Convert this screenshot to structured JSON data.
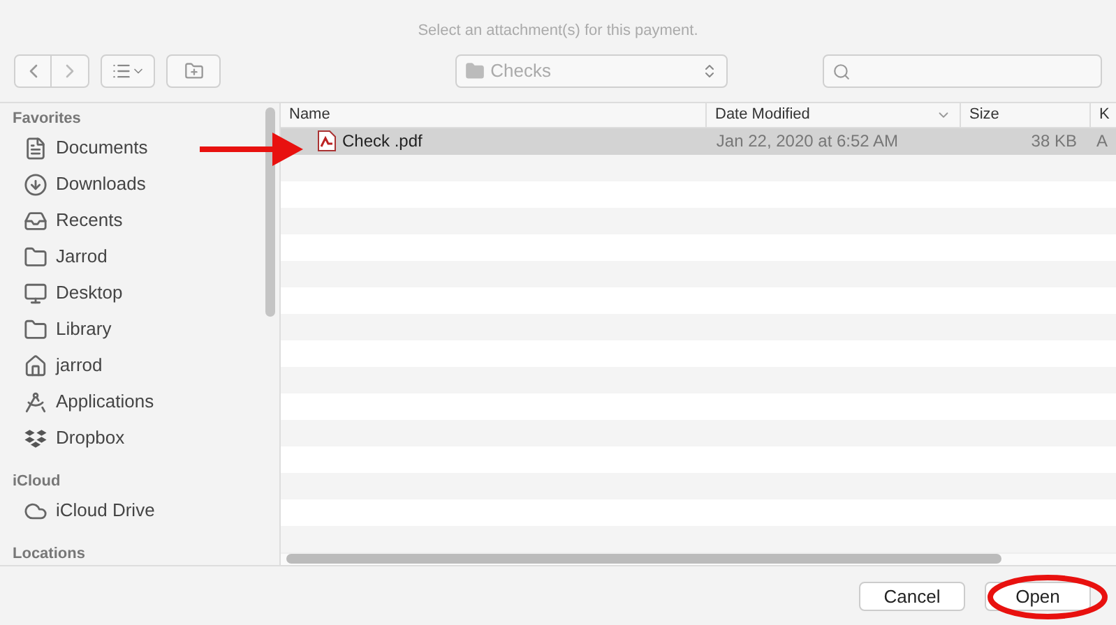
{
  "dialog": {
    "title": "Select an attachment(s) for this payment."
  },
  "toolbar": {
    "location": "Checks"
  },
  "sidebar": [
    {
      "heading": "Favorites",
      "items": [
        {
          "label": "Documents"
        },
        {
          "label": "Downloads"
        },
        {
          "label": "Recents"
        },
        {
          "label": "Jarrod"
        },
        {
          "label": "Desktop"
        },
        {
          "label": "Library"
        },
        {
          "label": "jarrod"
        },
        {
          "label": "Applications"
        },
        {
          "label": "Dropbox"
        }
      ]
    },
    {
      "heading": "iCloud",
      "items": [
        {
          "label": "iCloud Drive"
        }
      ]
    },
    {
      "heading": "Locations"
    }
  ],
  "table": {
    "columns": [
      "Name",
      "Date Modified",
      "Size",
      "K"
    ],
    "rows": [
      {
        "name": "Check .pdf",
        "date": "Jan 22, 2020 at 6:52 AM",
        "size": "38 KB",
        "kind": "A",
        "selected": true
      }
    ]
  },
  "buttons": {
    "cancel": "Cancel",
    "open": "Open"
  }
}
